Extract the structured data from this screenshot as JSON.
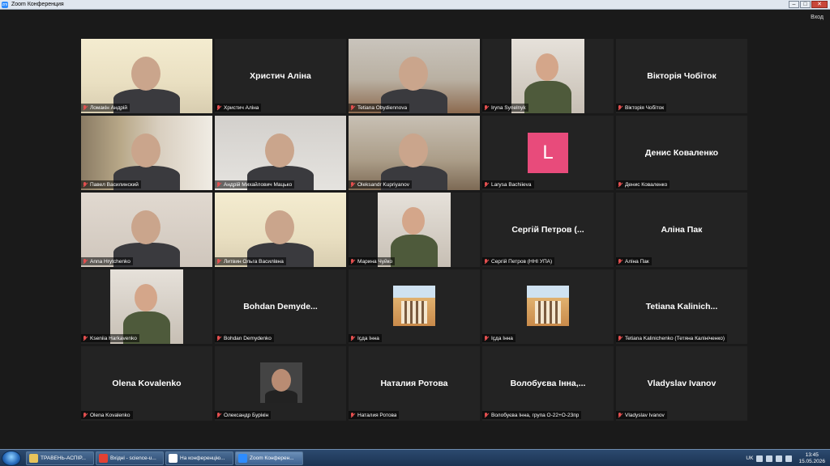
{
  "window": {
    "title": "Zoom Конференция",
    "exit_label": "Вход",
    "buttons": {
      "minimize": "–",
      "maximize": "□",
      "close": "✕"
    }
  },
  "tiles": [
    {
      "name": "Ломакін Андрій",
      "big": "",
      "kind": "video"
    },
    {
      "name": "Христич Аліна",
      "big": "Христич Аліна",
      "kind": "name"
    },
    {
      "name": "Tetiana Obydiennova",
      "big": "",
      "kind": "video"
    },
    {
      "name": "Iryna Synelnyk",
      "big": "",
      "kind": "photo"
    },
    {
      "name": "Вікторія Чобіток",
      "big": "Вікторія Чобіток",
      "kind": "name"
    },
    {
      "name": "Павел Василинский",
      "big": "",
      "kind": "video"
    },
    {
      "name": "Андрій Михайлович Мацько",
      "big": "",
      "kind": "video"
    },
    {
      "name": "Oleksandr Kupriyanov",
      "big": "",
      "kind": "video",
      "speaking": true
    },
    {
      "name": "Larysa Bachiieva",
      "big": "",
      "kind": "avatar",
      "avatar_letter": "L"
    },
    {
      "name": "Денис Коваленко",
      "big": "Денис Коваленко",
      "kind": "name"
    },
    {
      "name": "Anna Hrytchenko",
      "big": "",
      "kind": "video"
    },
    {
      "name": "Литвин Ольга Василівна",
      "big": "",
      "kind": "video"
    },
    {
      "name": "Марина Чуйко",
      "big": "",
      "kind": "photo"
    },
    {
      "name": "Сергій Петров (ННІ УПА)",
      "big": "Сергій Петров (...",
      "kind": "name"
    },
    {
      "name": "Аліна Пак",
      "big": "Аліна Пак",
      "kind": "name"
    },
    {
      "name": "Kseniia Harkavenko",
      "big": "",
      "kind": "photo"
    },
    {
      "name": "Bohdan Demydenko",
      "big": "Bohdan Demyde...",
      "kind": "name"
    },
    {
      "name": "Іҫда Інна",
      "big": "",
      "kind": "house"
    },
    {
      "name": "Іҫда Інна",
      "big": "",
      "kind": "house"
    },
    {
      "name": "Tetiana Kalinichenko (Тетяна Калініченко)",
      "big": "Tetiana Kalinich...",
      "kind": "name"
    },
    {
      "name": "Olena Kovalenko",
      "big": "Olena Kovalenko",
      "kind": "name"
    },
    {
      "name": "Олександр Бурікін",
      "big": "",
      "kind": "dark"
    },
    {
      "name": "Наталия Ротова",
      "big": "Наталия Ротова",
      "kind": "name"
    },
    {
      "name": "Волобуєва Інна, група О-22+О-23пр",
      "big": "Волобуєва Інна,...",
      "kind": "name"
    },
    {
      "name": "Vladyslav Ivanov",
      "big": "Vladyslav Ivanov",
      "kind": "name"
    }
  ],
  "taskbar": {
    "items": [
      {
        "label": "ТРАВЕНЬ-АСПІР...",
        "icon": "folder-icon",
        "color": "#e7c35a"
      },
      {
        "label": "Вхідні - science-u...",
        "icon": "chrome-icon",
        "color": "#e34133"
      },
      {
        "label": "На конференцію...",
        "icon": "document-icon",
        "color": "#ffffff"
      },
      {
        "label": "Zoom Конферен...",
        "icon": "zoom-icon",
        "color": "#2d8cff"
      }
    ],
    "language": "UK",
    "time": "13:45",
    "date": "15.05.2026"
  },
  "colors": {
    "speaking_outline": "#d8e65a",
    "avatar_bg": "#e84b7b",
    "muted": "#e34f4f"
  }
}
